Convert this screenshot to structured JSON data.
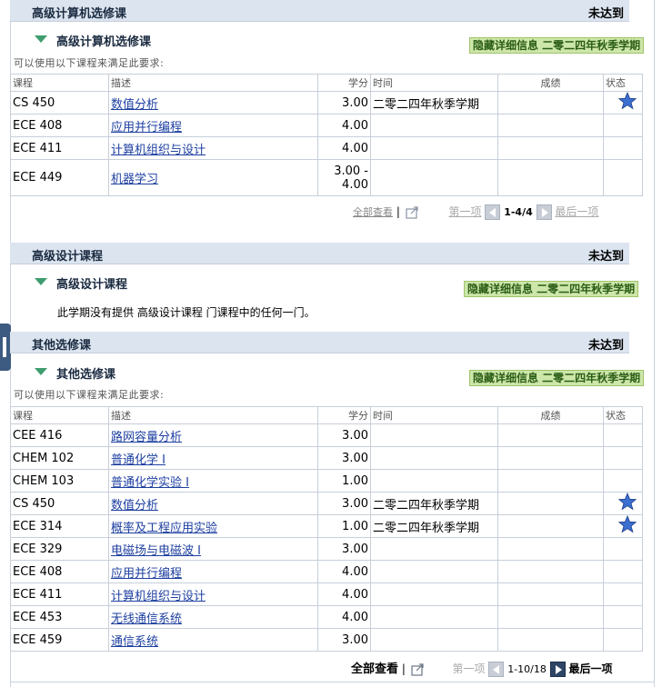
{
  "sections": [
    {
      "title": "高级计算机选修课",
      "status": "未达到",
      "requirement": {
        "title": "高级计算机选修课",
        "hide_label": "隐藏详细信息 二零二四年秋季学期",
        "hint": "可以使用以下课程来满足此要求:",
        "columns": [
          "课程",
          "描述",
          "学分",
          "时间",
          "成绩",
          "状态"
        ],
        "rows": [
          {
            "course": "CS 450",
            "desc": "数值分析",
            "credits": "3.00",
            "term": "二零二四年秋季学期",
            "grade": "",
            "status_icon": "star-icon"
          },
          {
            "course": "ECE 408",
            "desc": "应用并行编程",
            "credits": "4.00",
            "term": "",
            "grade": "",
            "status_icon": ""
          },
          {
            "course": "ECE 411",
            "desc": "计算机组织与设计",
            "credits": "4.00",
            "term": "",
            "grade": "",
            "status_icon": ""
          },
          {
            "course": "ECE 449",
            "desc": "机器学习",
            "credits_line1": "3.00 -",
            "credits_line2": "4.00",
            "term": "",
            "grade": "",
            "status_icon": ""
          }
        ],
        "pager": {
          "view_all": "全部查看",
          "first": "第一项",
          "range": "1-4/4",
          "last": "最后一项"
        }
      }
    },
    {
      "title": "高级设计课程",
      "status": "未达到",
      "requirement": {
        "title": "高级设计课程",
        "hide_label": "隐藏详细信息 二零二四年秋季学期",
        "note": "此学期没有提供 高级设计课程 门课程中的任何一门。"
      }
    },
    {
      "title": "其他选修课",
      "status": "未达到",
      "requirement": {
        "title": "其他选修课",
        "hide_label": "隐藏详细信息 二零二四年秋季学期",
        "hint": "可以使用以下课程来满足此要求:",
        "columns": [
          "课程",
          "描述",
          "学分",
          "时间",
          "成绩",
          "状态"
        ],
        "rows": [
          {
            "course": "CEE 416",
            "desc": "路网容量分析",
            "credits": "3.00",
            "term": "",
            "grade": "",
            "status_icon": ""
          },
          {
            "course": "CHEM 102",
            "desc": "普通化学 I",
            "credits": "3.00",
            "term": "",
            "grade": "",
            "status_icon": ""
          },
          {
            "course": "CHEM 103",
            "desc": "普通化学实验 I",
            "credits": "1.00",
            "term": "",
            "grade": "",
            "status_icon": ""
          },
          {
            "course": "CS 450",
            "desc": "数值分析",
            "credits": "3.00",
            "term": "二零二四年秋季学期",
            "grade": "",
            "status_icon": "star-icon"
          },
          {
            "course": "ECE 314",
            "desc": "概率及工程应用实验",
            "credits": "1.00",
            "term": "二零二四年秋季学期",
            "grade": "",
            "status_icon": "star-icon"
          },
          {
            "course": "ECE 329",
            "desc": "电磁场与电磁波 I",
            "credits": "3.00",
            "term": "",
            "grade": "",
            "status_icon": ""
          },
          {
            "course": "ECE 408",
            "desc": "应用并行编程",
            "credits": "4.00",
            "term": "",
            "grade": "",
            "status_icon": ""
          },
          {
            "course": "ECE 411",
            "desc": "计算机组织与设计",
            "credits": "4.00",
            "term": "",
            "grade": "",
            "status_icon": ""
          },
          {
            "course": "ECE 453",
            "desc": "无线通信系统",
            "credits": "4.00",
            "term": "",
            "grade": "",
            "status_icon": ""
          },
          {
            "course": "ECE 459",
            "desc": "通信系统",
            "credits": "3.00",
            "term": "",
            "grade": "",
            "status_icon": ""
          }
        ],
        "pager": {
          "view_all": "全部查看",
          "first": "第一项",
          "range": "1-10/18",
          "last": "最后一项"
        }
      }
    }
  ],
  "colors": {
    "header_bg": "#dbe4ef",
    "hide_btn_bg": "#cde6a9",
    "link": "#1d3fa0",
    "star": "#3b6fd0"
  }
}
